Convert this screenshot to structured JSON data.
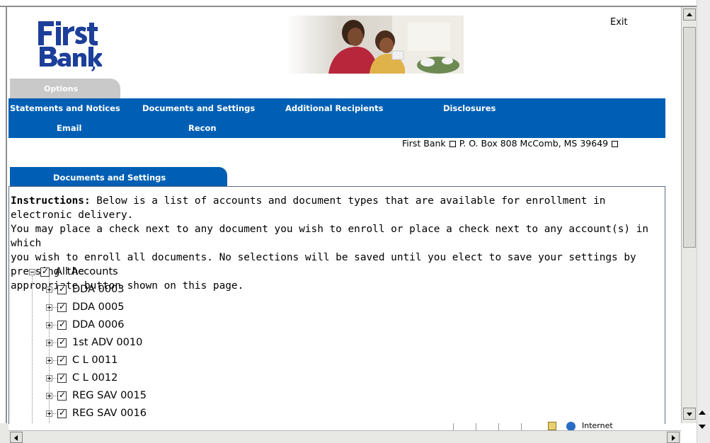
{
  "header": {
    "logo_text": "First Bank",
    "exit_label": "Exit"
  },
  "options_tab": {
    "label": "Options"
  },
  "nav": {
    "items": [
      {
        "label": "Statements and Notices"
      },
      {
        "label": "Documents and Settings"
      },
      {
        "label": "Additional Recipients"
      },
      {
        "label": "Disclosures"
      },
      {
        "label": "Email"
      },
      {
        "label": "Recon"
      }
    ]
  },
  "address": {
    "bank": "First Bank",
    "street": "P. O. Box 808 McComb, MS 39649"
  },
  "section_tab": {
    "label": "Documents and Settings"
  },
  "instructions": {
    "heading": "Instructions:",
    "lines": [
      " Below is a list of accounts and document types that are available for enrollment in electronic delivery.",
      "You may place a check next to any document you wish to enroll or place a check next to any account(s) in which",
      "you wish to enroll all documents. No selections will be saved until you elect to save your settings by pressing the",
      "appropriate button shown on this page."
    ]
  },
  "tree": {
    "root": {
      "label": "All Accounts",
      "checked": true,
      "expanded": true
    },
    "accounts": [
      {
        "label": "DDA 0003",
        "checked": true
      },
      {
        "label": "DDA 0005",
        "checked": true
      },
      {
        "label": "DDA 0006",
        "checked": true
      },
      {
        "label": "1st ADV 0010",
        "checked": true
      },
      {
        "label": "C L 0011",
        "checked": true
      },
      {
        "label": "C L 0012",
        "checked": true
      },
      {
        "label": "REG SAV 0015",
        "checked": true
      },
      {
        "label": "REG SAV 0016",
        "checked": true
      }
    ]
  },
  "status_bar": {
    "zone": "Internet"
  },
  "colors": {
    "nav_blue": "#005fb4",
    "tab_gray": "#c9c9c9"
  }
}
